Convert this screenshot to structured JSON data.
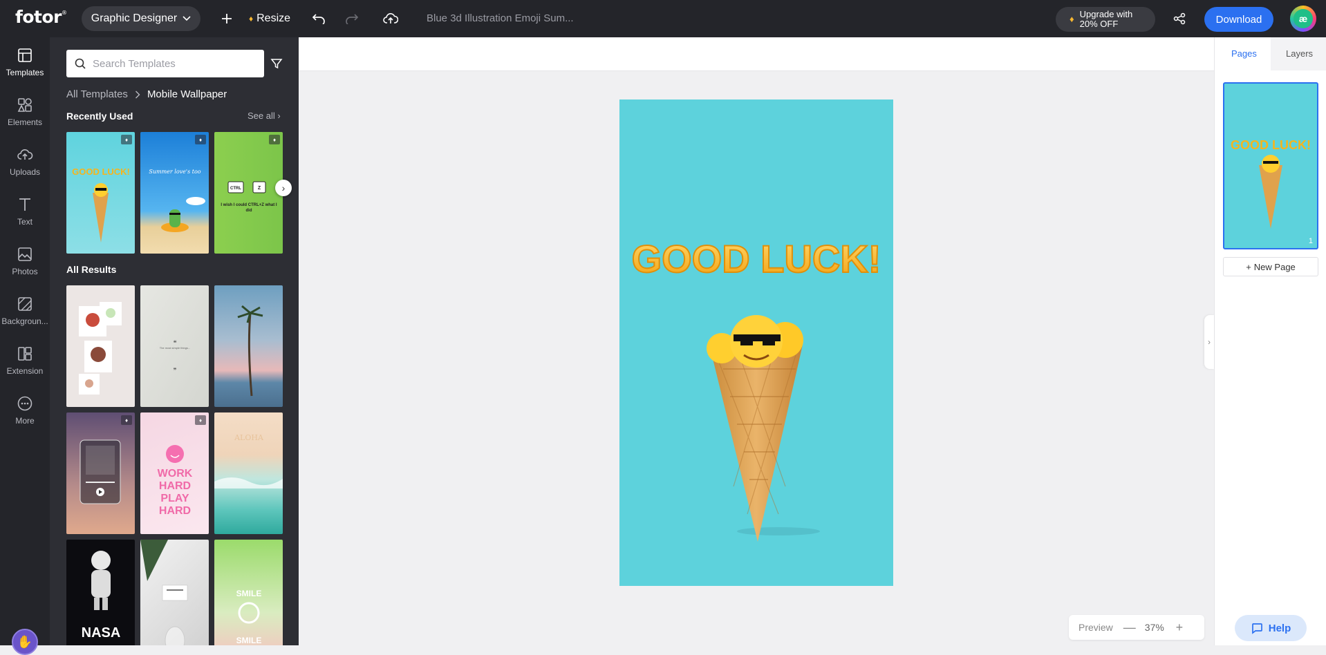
{
  "topbar": {
    "logo": "fotor",
    "logo_mark": "®",
    "role_label": "Graphic Designer",
    "resize_label": "Resize",
    "document_title": "Blue 3d Illustration Emoji Sum...",
    "upgrade_line1": "Upgrade with",
    "upgrade_line2": "20% OFF",
    "download_label": "Download",
    "avatar_initials": "æ"
  },
  "sidenav": {
    "items": [
      {
        "label": "Templates",
        "icon": "templates-icon"
      },
      {
        "label": "Elements",
        "icon": "elements-icon"
      },
      {
        "label": "Uploads",
        "icon": "upload-cloud-icon"
      },
      {
        "label": "Text",
        "icon": "text-icon"
      },
      {
        "label": "Photos",
        "icon": "photos-icon"
      },
      {
        "label": "Backgroun...",
        "icon": "background-icon"
      },
      {
        "label": "Extension",
        "icon": "extension-icon"
      },
      {
        "label": "More",
        "icon": "more-icon"
      }
    ]
  },
  "panel": {
    "search_placeholder": "Search Templates",
    "breadcrumb_root": "All Templates",
    "breadcrumb_current": "Mobile Wallpaper",
    "recently_used_title": "Recently Used",
    "see_all_label": "See all",
    "all_results_title": "All Results",
    "recent_templates": [
      {
        "text": "GOOD LUCK!",
        "premium": true
      },
      {
        "text": "Summer love's too",
        "premium": true
      },
      {
        "text": "I wish I could CTRL+Z what I did",
        "premium": true
      }
    ],
    "results": [
      {
        "text": "",
        "premium": false
      },
      {
        "text": "The most simple things...",
        "premium": false
      },
      {
        "text": "",
        "premium": false
      },
      {
        "text": "",
        "premium": true
      },
      {
        "text": "WORK HARD PLAY HARD",
        "premium": true
      },
      {
        "text": "ALOHA",
        "premium": false
      },
      {
        "text": "NASA",
        "premium": false
      },
      {
        "text": "",
        "premium": false
      },
      {
        "text": "SMILE",
        "premium": false
      }
    ]
  },
  "canvas": {
    "headline": "GOOD LUCK!",
    "background_color": "#5dd2dc"
  },
  "rightpanel": {
    "tab_pages": "Pages",
    "tab_layers": "Layers",
    "page_number": "1",
    "new_page_label": "New Page"
  },
  "zoom": {
    "preview_label": "Preview",
    "minus": "—",
    "value": "37%",
    "plus": "+"
  },
  "help_label": "Help",
  "colors": {
    "accent": "#2b70f0",
    "dark_bg": "#24252a",
    "panel_bg": "#2d2e34",
    "canvas_bg": "#f0f0f2"
  }
}
